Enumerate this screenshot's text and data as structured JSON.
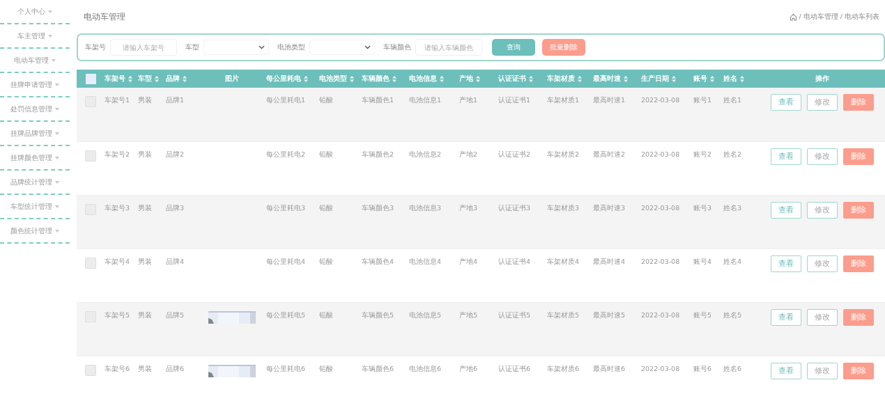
{
  "sidebar": {
    "items": [
      {
        "label": "个人中心"
      },
      {
        "label": "车主管理"
      },
      {
        "label": "电动车管理"
      },
      {
        "label": "挂牌申请管理"
      },
      {
        "label": "处罚信息管理"
      },
      {
        "label": "挂牌品牌管理"
      },
      {
        "label": "挂牌颜色管理"
      },
      {
        "label": "品牌统计管理"
      },
      {
        "label": "车型统计管理"
      },
      {
        "label": "颜色统计管理"
      }
    ]
  },
  "page_title": "电动车管理",
  "breadcrumb": "/ 电动车管理 / 电动车列表",
  "search": {
    "fields": [
      {
        "kind": "input",
        "label": "车架号",
        "placeholder": "请输入车架号"
      },
      {
        "kind": "select",
        "label": "车型"
      },
      {
        "kind": "select",
        "label": "电池类型"
      },
      {
        "kind": "input",
        "label": "车辆颜色",
        "placeholder": "请输入车辆颜色"
      }
    ],
    "buttons": [
      {
        "kind": "primary",
        "label": "查询"
      },
      {
        "kind": "danger",
        "label": "批量删除"
      }
    ]
  },
  "table": {
    "all_selected": false,
    "columns": [
      {
        "label": "车架号",
        "sortable": true
      },
      {
        "label": "车型",
        "sortable": true
      },
      {
        "label": "品牌",
        "sortable": true
      },
      {
        "label": "图片",
        "sortable": false
      },
      {
        "label": "每公里耗电",
        "sortable": true
      },
      {
        "label": "电池类型",
        "sortable": true
      },
      {
        "label": "车辆颜色",
        "sortable": true
      },
      {
        "label": "电池信息",
        "sortable": true
      },
      {
        "label": "产地",
        "sortable": true
      },
      {
        "label": "认证证书",
        "sortable": true
      },
      {
        "label": "车架材质",
        "sortable": true
      },
      {
        "label": "最高时速",
        "sortable": true
      },
      {
        "label": "生产日期",
        "sortable": true
      },
      {
        "label": "账号",
        "sortable": true
      },
      {
        "label": "姓名",
        "sortable": true
      },
      {
        "label": "操作",
        "sortable": false
      }
    ],
    "rows": [
      {
        "selected": false,
        "cells": [
          "车架号1",
          "男装",
          "品牌1",
          "",
          "每公里耗电1",
          "铅酸",
          "车辆颜色1",
          "电池信息1",
          "产地1",
          "认证证书1",
          "车架材质1",
          "最高时速1",
          "2022-03-08",
          "账号1",
          "姓名1"
        ],
        "actions": [
          {
            "kind": "view",
            "label": "查看"
          },
          {
            "kind": "edit",
            "label": "修改"
          },
          {
            "kind": "delete",
            "label": "删除"
          }
        ]
      },
      {
        "selected": false,
        "cells": [
          "车架号2",
          "男装",
          "品牌2",
          "",
          "每公里耗电2",
          "铅酸",
          "车辆颜色2",
          "电池信息2",
          "产地2",
          "认证证书2",
          "车架材质2",
          "最高时速2",
          "2022-03-08",
          "账号2",
          "姓名2"
        ],
        "actions": [
          {
            "kind": "view",
            "label": "查看"
          },
          {
            "kind": "edit",
            "label": "修改"
          },
          {
            "kind": "delete",
            "label": "删除"
          }
        ]
      },
      {
        "selected": false,
        "cells": [
          "车架号3",
          "男装",
          "品牌3",
          "",
          "每公里耗电3",
          "铅酸",
          "车辆颜色3",
          "电池信息3",
          "产地3",
          "认证证书3",
          "车架材质3",
          "最高时速3",
          "2022-03-08",
          "账号3",
          "姓名3"
        ],
        "actions": [
          {
            "kind": "view",
            "label": "查看"
          },
          {
            "kind": "edit",
            "label": "修改"
          },
          {
            "kind": "delete",
            "label": "删除"
          }
        ]
      },
      {
        "selected": false,
        "cells": [
          "车架号4",
          "男装",
          "品牌4",
          "",
          "每公里耗电4",
          "铅酸",
          "车辆颜色4",
          "电池信息4",
          "产地4",
          "认证证书4",
          "车架材质4",
          "最高时速4",
          "2022-03-08",
          "账号4",
          "姓名4"
        ],
        "actions": [
          {
            "kind": "view",
            "label": "查看"
          },
          {
            "kind": "edit",
            "label": "修改"
          },
          {
            "kind": "delete",
            "label": "删除"
          }
        ]
      },
      {
        "selected": false,
        "picture": true,
        "cells": [
          "车架号5",
          "男装",
          "品牌5",
          "",
          "每公里耗电5",
          "铅酸",
          "车辆颜色5",
          "电池信息5",
          "产地5",
          "认证证书5",
          "车架材质5",
          "最高时速5",
          "2022-03-08",
          "账号5",
          "姓名5"
        ],
        "actions": [
          {
            "kind": "view",
            "label": "查看"
          },
          {
            "kind": "edit",
            "label": "修改"
          },
          {
            "kind": "delete",
            "label": "删除"
          }
        ]
      },
      {
        "selected": false,
        "picture": true,
        "cells": [
          "车架号6",
          "男装",
          "品牌6",
          "",
          "每公里耗电6",
          "铅酸",
          "车辆颜色6",
          "电池信息6",
          "产地6",
          "认证证书6",
          "车架材质6",
          "最高时速6",
          "2022-03-08",
          "账号6",
          "姓名6"
        ],
        "actions": [
          {
            "kind": "view",
            "label": "查看"
          },
          {
            "kind": "edit",
            "label": "修改"
          },
          {
            "kind": "delete",
            "label": "删除"
          }
        ]
      }
    ]
  }
}
